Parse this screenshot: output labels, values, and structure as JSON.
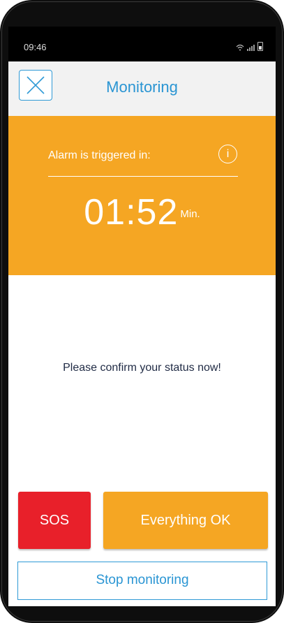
{
  "status_bar": {
    "time": "09:46",
    "icons": [
      "wifi-icon",
      "signal-icon",
      "battery-icon"
    ]
  },
  "header": {
    "title": "Monitoring",
    "close_icon": "close-icon"
  },
  "alarm": {
    "label": "Alarm is triggered in:",
    "info_icon_glyph": "i",
    "countdown": "01:52",
    "unit": "Min."
  },
  "main": {
    "prompt": "Please confirm your status now!"
  },
  "actions": {
    "sos_label": "SOS",
    "ok_label": "Everything OK",
    "stop_label": "Stop monitoring"
  },
  "colors": {
    "accent_blue": "#2a95d3",
    "alarm_orange": "#f5a623",
    "sos_red": "#e8202a"
  }
}
